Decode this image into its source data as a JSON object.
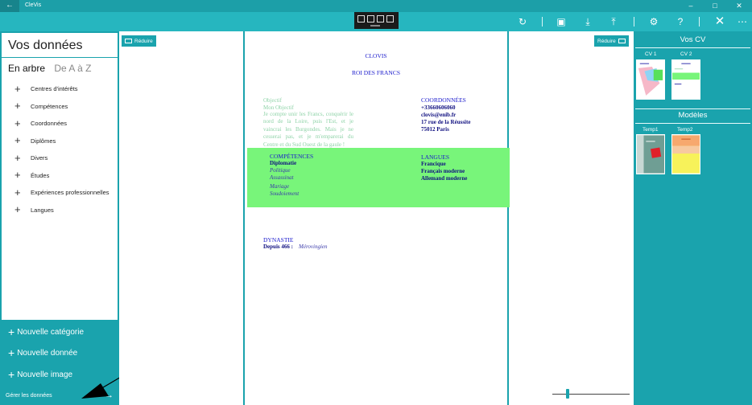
{
  "window": {
    "app_title": "CleVis",
    "back_icon": "back-arrow-icon",
    "controls": [
      "minimize-icon",
      "maximize-icon",
      "close-icon"
    ]
  },
  "toolbar": {
    "icons": [
      "refresh-icon",
      "save-icon",
      "download-icon",
      "upload-icon",
      "settings-icon",
      "help-icon",
      "close-icon",
      "more-icon"
    ],
    "mode_icons": [
      "edit-mode-icon",
      "comment-mode-icon",
      "preview-mode-icon",
      "share-mode-icon"
    ]
  },
  "left_panel": {
    "title": "Vos données",
    "tabs": [
      {
        "label": "En arbre",
        "active": true
      },
      {
        "label": "De A à Z",
        "active": false
      }
    ],
    "tree_items": [
      "Centres d'intérêts",
      "Compétences",
      "Coordonnées",
      "Diplômes",
      "Divers",
      "Études",
      "Expériences professionnelles",
      "Langues"
    ]
  },
  "actions": {
    "new_category": "Nouvelle catégorie",
    "new_data": "Nouvelle donnée",
    "new_image": "Nouvelle image",
    "manage": "Gérer les données"
  },
  "center": {
    "reduce_left": "Réduire",
    "reduce_right": "Réduire",
    "zoom_fraction": 0.2
  },
  "document": {
    "name": "CLOVIS",
    "subtitle": "ROI DES FRANCS",
    "objective_title": "Objectif",
    "objective_label": "Mon Objectif",
    "objective_text": "Je compte unir les Francs, conquérir le nord de la Loire, puis l'Est, et je vaincrai les Burgondes. Mais je ne cesserai pas, et je m'emparerai du Centre et du Sud Ouest de la gaule !",
    "contact_title": "COORDONNÉES",
    "contact_lines": [
      "+33660606060",
      "clovis@enib.fr",
      "17 rue de la Réussite",
      "75012 Paris"
    ],
    "skills_title": "COMPÉTENCES",
    "skills_head": "Diplomatie",
    "skills_items": [
      "Politique",
      "Assassinat",
      "Mariage",
      "Soudoiement"
    ],
    "languages_title": "LANGUES",
    "languages": [
      "Francique",
      "Français moderne",
      "Allemand moderne"
    ],
    "dynasty_title": "DYNASTIE",
    "dynasty_since": "Depuis 466 :",
    "dynasty_name": "Mérovingien",
    "band_color": "#78f57a"
  },
  "right_panel": {
    "cv_header": "Vos CV",
    "cvs": [
      "CV 1",
      "CV 2"
    ],
    "models_header": "Modèles",
    "templates": [
      "Temp1",
      "Temp2"
    ]
  },
  "colors": {
    "accent": "#1aa3ad",
    "toolbar": "#26b6bf",
    "doc_blue": "#1a1acc",
    "doc_navy": "#101080"
  }
}
